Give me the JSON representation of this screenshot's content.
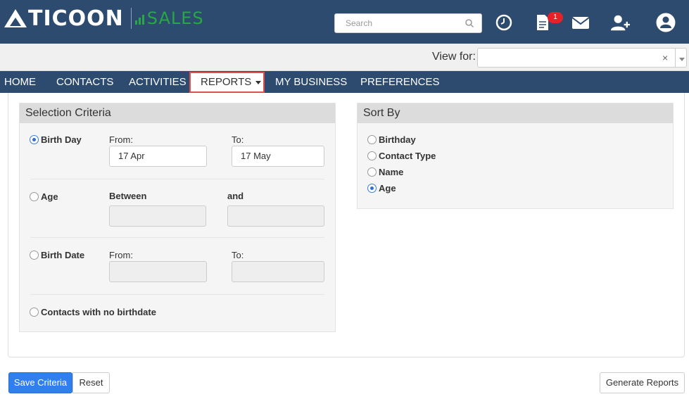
{
  "header": {
    "logo_main": "TICOON",
    "logo_sub": "SALES",
    "search_placeholder": "Search",
    "notification_count": "1"
  },
  "viewbar": {
    "label": "View for:",
    "value": "",
    "clear": "×"
  },
  "nav": {
    "items": [
      "HOME",
      "CONTACTS",
      "ACTIVITIES",
      "REPORTS",
      "MY BUSINESS",
      "PREFERENCES"
    ]
  },
  "selection": {
    "title": "Selection Criteria",
    "birthday": {
      "label": "Birth Day",
      "from_label": "From:",
      "to_label": "To:",
      "from_value": "17 Apr",
      "to_value": "17 May",
      "checked": true
    },
    "age": {
      "label": "Age",
      "between_label": "Between",
      "and_label": "and",
      "checked": false
    },
    "birthdate": {
      "label": "Birth Date",
      "from_label": "From:",
      "to_label": "To:",
      "checked": false
    },
    "nobirth": {
      "label": "Contacts with no birthdate",
      "checked": false
    }
  },
  "sort": {
    "title": "Sort By",
    "options": [
      {
        "label": "Birthday",
        "checked": false
      },
      {
        "label": "Contact Type",
        "checked": false
      },
      {
        "label": "Name",
        "checked": false
      },
      {
        "label": "Age",
        "checked": true
      }
    ]
  },
  "buttons": {
    "save": "Save Criteria",
    "reset": "Reset",
    "generate": "Generate Reports"
  },
  "colors": {
    "header_bg": "#2d4a6f",
    "accent_green": "#28a745",
    "primary_blue": "#2f80ed",
    "badge_red": "#e8202a",
    "highlight_red": "#d9534f"
  }
}
